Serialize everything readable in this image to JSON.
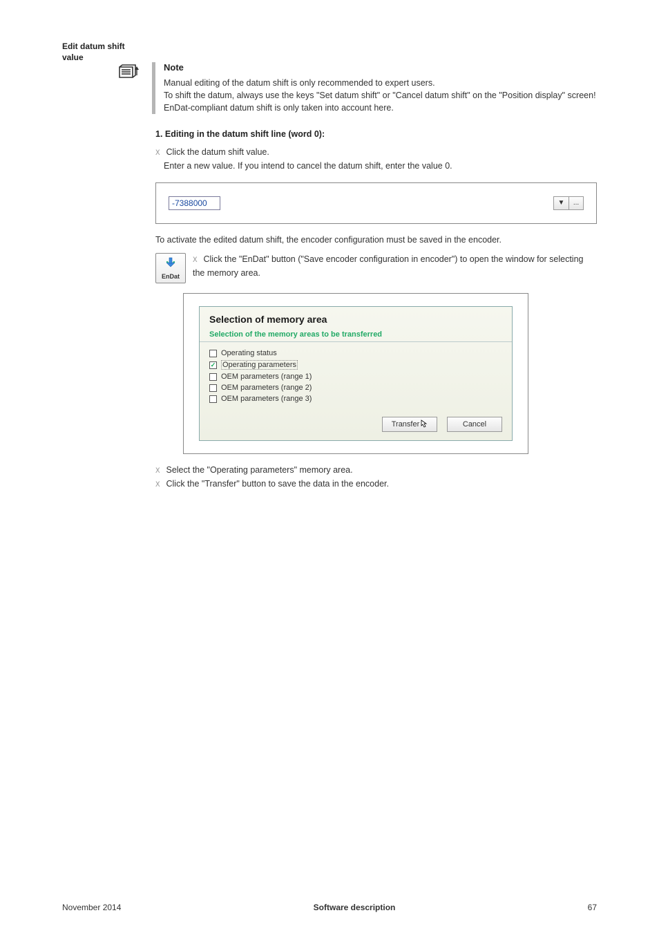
{
  "sidebar": {
    "title": "Edit datum shift value"
  },
  "note": {
    "heading": "Note",
    "body": "Manual editing of the datum shift is only recommended to expert users.\nTo shift the datum, always use the keys \"Set datum shift\"  or \"Cancel datum shift\" on the \"Position display\" screen!\nEnDat-compliant datum shift is only taken into account here."
  },
  "section1": {
    "heading": "1. Editing in the datum shift line (word 0):",
    "step1": "Click the datum shift value.",
    "step2": "Enter a new value. If you intend to cancel the datum shift, enter the value 0.",
    "input_value": "-7388000",
    "dropdown_glyph": "▼",
    "ellipsis_glyph": "..."
  },
  "activate_line": "To activate the edited datum shift, the encoder configuration must be saved in the encoder.",
  "endat": {
    "label": "EnDat",
    "instruction": "Click the \"EnDat\" button (\"Save encoder configuration in encoder\") to open the window for selecting the memory area."
  },
  "dialog": {
    "title": "Selection of memory area",
    "subtitle": "Selection of the memory areas to be transferred",
    "items": [
      {
        "label": "Operating status",
        "checked": false,
        "selected": false
      },
      {
        "label": "Operating parameters",
        "checked": true,
        "selected": true
      },
      {
        "label": "OEM parameters (range 1)",
        "checked": false,
        "selected": false
      },
      {
        "label": "OEM parameters (range 2)",
        "checked": false,
        "selected": false
      },
      {
        "label": "OEM parameters (range 3)",
        "checked": false,
        "selected": false
      }
    ],
    "transfer": "Transfer",
    "cancel": "Cancel"
  },
  "closing": {
    "s1": "Select the \"Operating parameters\" memory area.",
    "s2": "Click the \"Transfer\" button to save the data in the encoder."
  },
  "footer": {
    "left": "November 2014",
    "center": "Software description",
    "right": "67"
  }
}
